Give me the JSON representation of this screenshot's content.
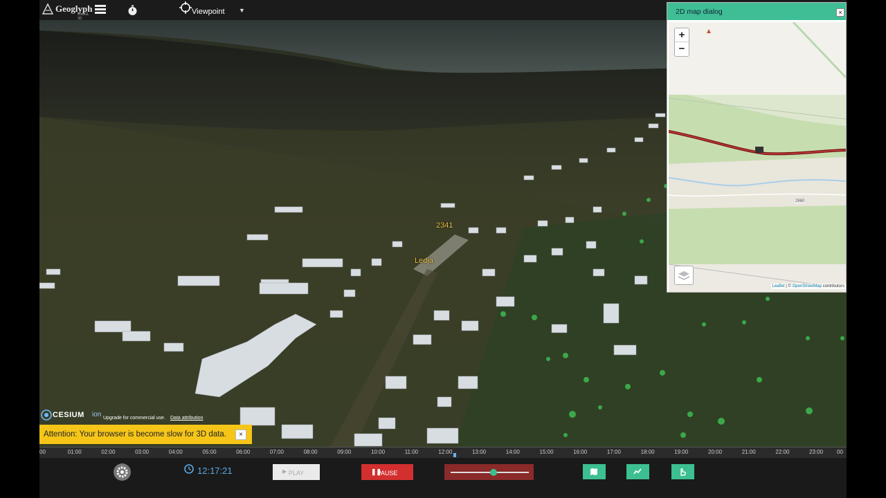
{
  "app": {
    "logo_name": "Geoglyph",
    "logo_sub": "WebGL 3D",
    "menu_icon": "hamburger-menu-icon",
    "timer_icon": "stopwatch-icon",
    "viewpoint_label": "Viewpoint",
    "viewpoint_icon": "viewpoint-icon"
  },
  "scene": {
    "labels": [
      "2341",
      "Ledja"
    ]
  },
  "credit": {
    "ion_text": "CESIUM",
    "ion_sub": "ion",
    "upgrade": "Upgrade for commercial use.",
    "attribution": "Data attribution"
  },
  "attention": {
    "text": "Attention: Your browser is become slow for 3D data.",
    "close": "×"
  },
  "dialog": {
    "title": "2D map dialog",
    "close": "×",
    "zoom_in": "+",
    "zoom_out": "−",
    "attribution_leaflet": "Leaflet",
    "attribution_sep": " | © ",
    "attribution_osm": "OpenStreetMap",
    "attribution_tail": " contributors",
    "road_number": "2660"
  },
  "timeline": {
    "ticks": [
      "00",
      "01:00",
      "02:00",
      "03:00",
      "04:00",
      "05:00",
      "06:00",
      "07:00",
      "08:00",
      "09:00",
      "10:00",
      "11:00",
      "12:00",
      "13:00",
      "14:00",
      "15:00",
      "16:00",
      "17:00",
      "18:00",
      "19:00",
      "20:00",
      "21:00",
      "22:00",
      "23:00",
      "00"
    ]
  },
  "controls": {
    "clock_time": "12:17:21",
    "play_label": "PLAY",
    "pause_label": "PAUSE",
    "speed_fraction": 0.55,
    "colors": {
      "accent_green": "#3cc091",
      "pause_red": "#d32f2f",
      "clock_blue": "#5aa9e6",
      "attention_yellow": "#f5c518",
      "dialog_header": "#3fbe96"
    }
  }
}
